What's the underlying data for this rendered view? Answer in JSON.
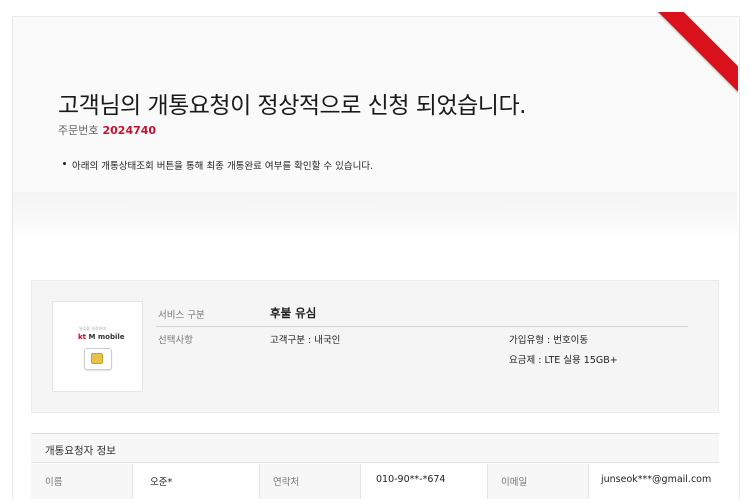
{
  "header": {
    "headline": "고객님의 개통요청이 정상적으로 신청 되었습니다.",
    "order_label": "주문번호",
    "order_number": "2024740",
    "notice": "아래의 개통상태조회 버튼을 통해 최종 개통완료 여부를 확인할 수 있습니다."
  },
  "product": {
    "image": {
      "caption": "유심을 설정하여",
      "brand_kt": "kt",
      "brand_rest": " M mobile"
    },
    "service_label": "서비스 구분",
    "service_value": "후불 유심",
    "options_label": "선택사항",
    "customer_type": "고객구분 : 내국인",
    "join_type": "가입유형 : 번호이동",
    "plan": "요금제 : LTE 실용 15GB+"
  },
  "requester": {
    "title": "개통요청자 정보",
    "name_label": "이름",
    "name_value": "오준*",
    "phone_label": "연락처",
    "phone_value": "010-90**-*674",
    "email_label": "이메일",
    "email_value": "junseok***@gmail.com"
  },
  "colors": {
    "accent": "#c8102e",
    "ribbon": "#d9111c"
  }
}
